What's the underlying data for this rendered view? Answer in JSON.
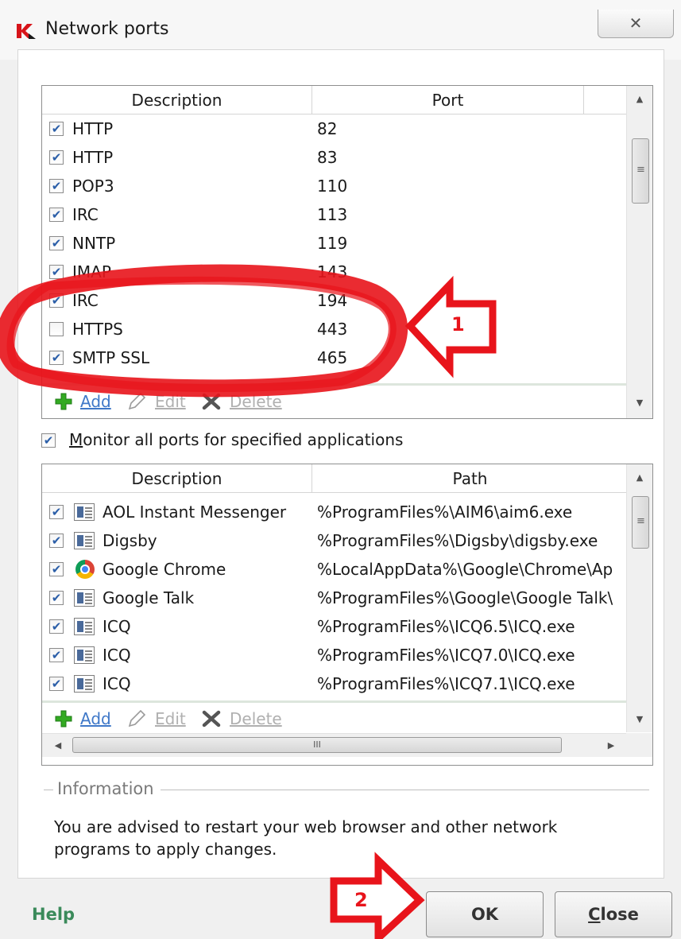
{
  "window": {
    "title": "Network ports",
    "close_glyph": "✕"
  },
  "ports_table": {
    "columns": [
      "Description",
      "Port"
    ],
    "rows": [
      {
        "checked": true,
        "description": "HTTP",
        "port": "82"
      },
      {
        "checked": true,
        "description": "HTTP",
        "port": "83"
      },
      {
        "checked": true,
        "description": "POP3",
        "port": "110"
      },
      {
        "checked": true,
        "description": "IRC",
        "port": "113"
      },
      {
        "checked": true,
        "description": "NNTP",
        "port": "119"
      },
      {
        "checked": true,
        "description": "IMAP",
        "port": "143"
      },
      {
        "checked": true,
        "description": "IRC",
        "port": "194"
      },
      {
        "checked": false,
        "description": "HTTPS",
        "port": "443"
      },
      {
        "checked": true,
        "description": "SMTP SSL",
        "port": "465"
      }
    ],
    "toolbar": {
      "add": "Add",
      "edit": "Edit",
      "delete": "Delete"
    }
  },
  "monitor_all": {
    "checked": true,
    "label_accel": "M",
    "label_rest": "onitor all ports for specified applications"
  },
  "apps_table": {
    "columns": [
      "Description",
      "Path"
    ],
    "rows": [
      {
        "checked": true,
        "icon": "app-window-icon",
        "description": "AOL Instant Messenger",
        "path": "%ProgramFiles%\\AIM6\\aim6.exe"
      },
      {
        "checked": true,
        "icon": "app-window-icon",
        "description": "Digsby",
        "path": "%ProgramFiles%\\Digsby\\digsby.exe"
      },
      {
        "checked": true,
        "icon": "chrome-icon",
        "description": "Google Chrome",
        "path": "%LocalAppData%\\Google\\Chrome\\Ap"
      },
      {
        "checked": true,
        "icon": "app-window-icon",
        "description": "Google Talk",
        "path": "%ProgramFiles%\\Google\\Google Talk\\"
      },
      {
        "checked": true,
        "icon": "app-window-icon",
        "description": "ICQ",
        "path": "%ProgramFiles%\\ICQ6.5\\ICQ.exe"
      },
      {
        "checked": true,
        "icon": "app-window-icon",
        "description": "ICQ",
        "path": "%ProgramFiles%\\ICQ7.0\\ICQ.exe"
      },
      {
        "checked": true,
        "icon": "app-window-icon",
        "description": "ICQ",
        "path": "%ProgramFiles%\\ICQ7.1\\ICQ.exe"
      }
    ],
    "toolbar": {
      "add": "Add",
      "edit": "Edit",
      "delete": "Delete"
    },
    "hscroll_grip": "III"
  },
  "information": {
    "label": "Information",
    "text": "You are advised to restart your web browser and other network programs to apply changes."
  },
  "footer": {
    "help": "Help",
    "ok": "OK",
    "close_accel": "C",
    "close_rest": "lose"
  },
  "annotations": {
    "marker_1": "1",
    "marker_2": "2",
    "color": "#e8141b"
  },
  "colors": {
    "link": "#3f78c8",
    "help": "#3a8a5a",
    "check": "#2b5ea8"
  }
}
